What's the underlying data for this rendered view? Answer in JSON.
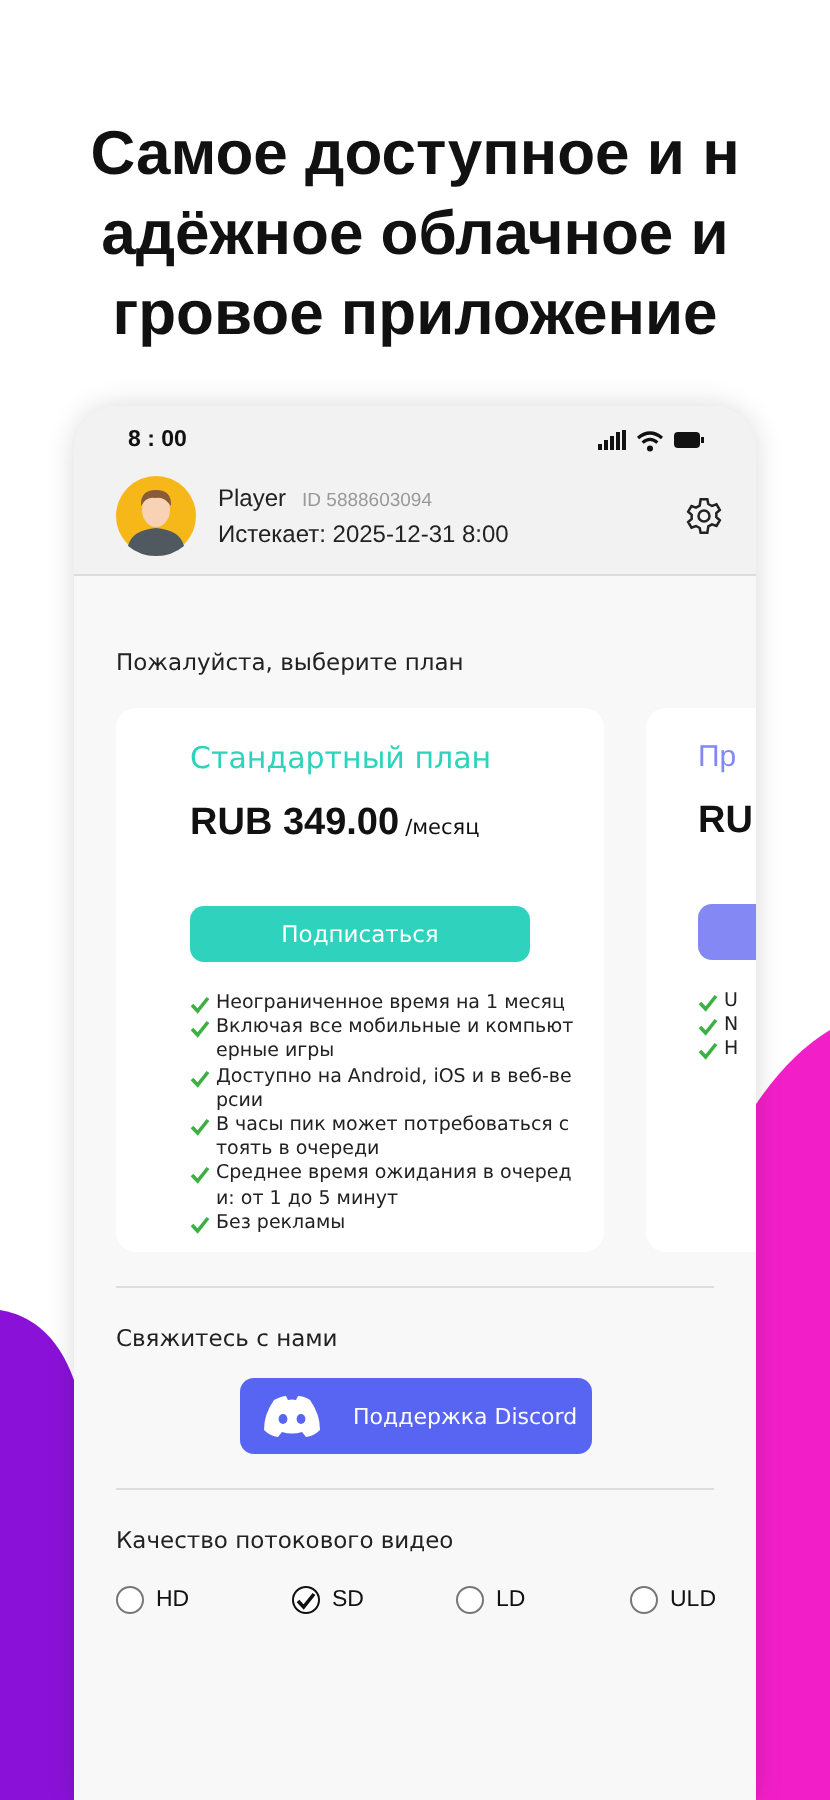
{
  "headline": {
    "lines": [
      "Самое доступное и н",
      "адёжное облачное и",
      "гровое приложение"
    ]
  },
  "status_bar": {
    "time": "8 : 00"
  },
  "profile": {
    "name": "Player",
    "id": "ID 5888603094",
    "expires": "Истекает: 2025-12-31 8:00"
  },
  "plans_title": "Пожалуйста, выберите план",
  "plans": [
    {
      "title": "Стандартный план",
      "color": "#2fd3bd",
      "price": "RUB 349.00",
      "period": "/месяц",
      "button": "Подписаться",
      "features": [
        "Неограниченное время на 1 месяц",
        "Включая все мобильные и компьютерные игры",
        "Доступно на Android, iOS и в веб-версии",
        "В часы пик может потребоваться стоять в очереди",
        "Среднее время ожидания в очереди: от 1 до 5 минут",
        "Без рекламы"
      ]
    },
    {
      "title": "Пр",
      "color": "#8388f5",
      "price": "RU",
      "features": [
        "U",
        "N",
        "H"
      ]
    }
  ],
  "contact": {
    "title": "Свяжитесь с нами",
    "button": "Поддержка Discord"
  },
  "quality": {
    "title": "Качество потокового видео",
    "options": [
      {
        "label": "HD",
        "selected": false
      },
      {
        "label": "SD",
        "selected": true
      },
      {
        "label": "LD",
        "selected": false
      },
      {
        "label": "ULD",
        "selected": false
      }
    ]
  }
}
